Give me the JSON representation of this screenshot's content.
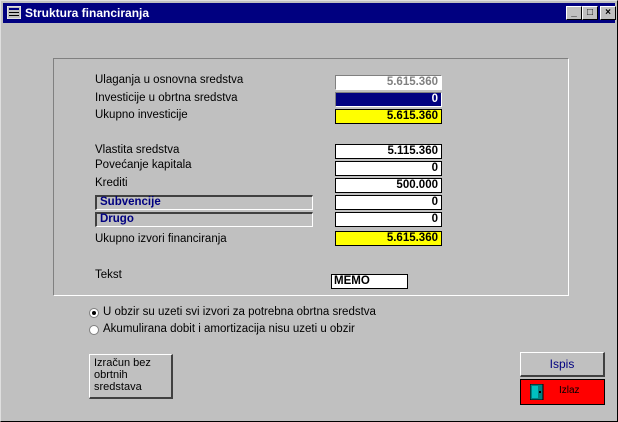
{
  "window": {
    "title": "Struktura financiranja"
  },
  "title_buttons": {
    "minimize": "_",
    "maximize": "□",
    "close": "×"
  },
  "form": {
    "ulaganja": {
      "label": "Ulaganja u osnovna sredstva",
      "value": "5.615.360"
    },
    "investicije": {
      "label": "Investicije u obrtna sredstva",
      "value": "0"
    },
    "ukupno_investicije": {
      "label": "Ukupno investicije",
      "value": "5.615.360"
    },
    "vlastita": {
      "label": "Vlastita sredstva",
      "value": "5.115.360"
    },
    "povecanje": {
      "label": "Povećanje kapitala",
      "value": "0"
    },
    "krediti": {
      "label": "Krediti",
      "value": "500.000"
    },
    "subvencije": {
      "label": "Subvencije",
      "value": "0"
    },
    "drugo": {
      "label": "Drugo",
      "value": "0"
    },
    "ukupno_izvori": {
      "label": "Ukupno izvori financiranja",
      "value": "5.615.360"
    },
    "tekst": {
      "label": "Tekst",
      "value": "MEMO"
    }
  },
  "options": [
    {
      "label": "U obzir su uzeti svi izvori za potrebna obrtna sredstva",
      "selected": true
    },
    {
      "label": "Akumulirana dobit i amortizacija nisu uzeti u obzir",
      "selected": false
    }
  ],
  "buttons": {
    "izracun": "Izračun bez obrtnih sredstava",
    "ispis": "Ispis",
    "izlaz": "Izlaz"
  },
  "colors": {
    "highlight_yellow": "#ffff00",
    "selected_navy": "#000080",
    "exit_red": "#ff0000"
  }
}
